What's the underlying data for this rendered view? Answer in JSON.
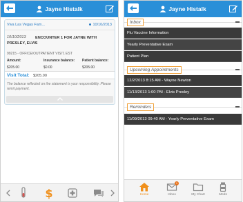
{
  "colors": {
    "topbar": "#2a8fd8",
    "accent": "#f0901c",
    "row_bg": "#3a3a3a"
  },
  "left": {
    "user_name": "Jayne Histalk",
    "encounter": {
      "location": "Viva Las Vegas Fam...",
      "date_header": "10/10/2013",
      "date": "10/10/2013",
      "title": "ENCOUNTER 1 FOR JAYNE WITH PRESLEY, ELVIS",
      "code": "99215 - OFFICE/OUTPATIENT VISIT, EST",
      "amount_label": "Amount:",
      "amount_value": "$205.00",
      "insurance_label": "Insurance balance:",
      "insurance_value": "$0.00",
      "patient_label": "Patient balance:",
      "patient_value": "$205.00",
      "visit_total_label": "Visit Total:",
      "visit_total_value": "$205.00",
      "note": "The balance reflected on the statement is your responsibility. Please remit payment."
    },
    "bottom_icons": [
      "back-chevron-icon",
      "test-tube-icon",
      "dollar-icon",
      "medical-kit-icon",
      "chat-icon",
      "forward-chevron-icon"
    ]
  },
  "right": {
    "user_name": "Jayne Histalk",
    "inbox_title": "Inbox",
    "inbox_items": [
      "Flu Vaccine Information",
      "Yearly Preventative Exam",
      "Patient Plan"
    ],
    "appointments_title": "Upcoming Appointments",
    "appointments": [
      "12/2/2013 8:15 AM - Wayne Newton",
      "11/13/2013 1:00 PM - Elvis Presley"
    ],
    "reminders_title": "Reminders",
    "reminders": [
      "11/09/2013 09:40 AM - Yearly Preventative Exam"
    ],
    "tabs": [
      {
        "label": "Home",
        "icon": "home-icon"
      },
      {
        "label": "Inbox",
        "icon": "mail-icon",
        "badge": "1"
      },
      {
        "label": "My Chart",
        "icon": "folder-icon"
      },
      {
        "label": "Meds",
        "icon": "pill-bottle-icon"
      }
    ]
  }
}
